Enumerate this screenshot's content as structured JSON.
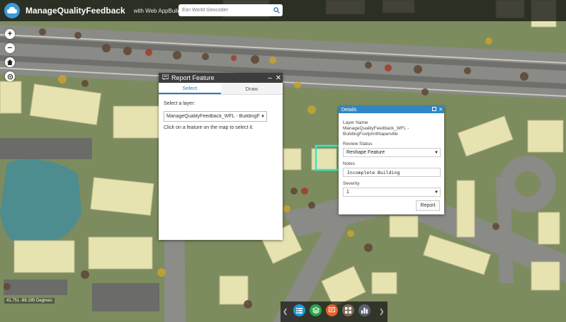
{
  "header": {
    "title": "ManageQualityFeedback",
    "subtitle": "with Web AppBuilder for ArcGIS",
    "search_placeholder": "Esri World Geocoder"
  },
  "map_controls": {
    "zoom_in": "+",
    "zoom_out": "−"
  },
  "report_panel": {
    "title": "Report Feature",
    "tabs": [
      {
        "label": "Select",
        "active": true
      },
      {
        "label": "Draw",
        "active": false
      }
    ],
    "layer_label": "Select a layer:",
    "layer_value": "ManageQualityFeedback_WFL - BuildingF",
    "hint": "Click on a feature on the map to select it."
  },
  "details_panel": {
    "title": "Details",
    "layer_name_label": "Layer Name",
    "layer_name_value": "ManageQualityFeedback_WFL - BuildingFootprintNaperville",
    "review_status_label": "Review Status",
    "review_status_value": "Reshape Feature",
    "notes_label": "Notes",
    "notes_value": "Incomplete Building",
    "severity_label": "Severity",
    "severity_value": "1",
    "report_button": "Report"
  },
  "coordinates": "41.751  -88.185 Degrees",
  "toolbar": {
    "buttons": [
      {
        "icon": "list-icon",
        "color": "#1f9ad6"
      },
      {
        "icon": "layers-icon",
        "color": "#2aa44a"
      },
      {
        "icon": "report-icon",
        "color": "#e8612c"
      },
      {
        "icon": "grid-icon",
        "color": "#7a6a5a"
      },
      {
        "icon": "chart-icon",
        "color": "#5a6470"
      }
    ]
  },
  "colors": {
    "header_bg": "#141414",
    "accent": "#2e86c8",
    "highlight": "#35e6c5"
  }
}
